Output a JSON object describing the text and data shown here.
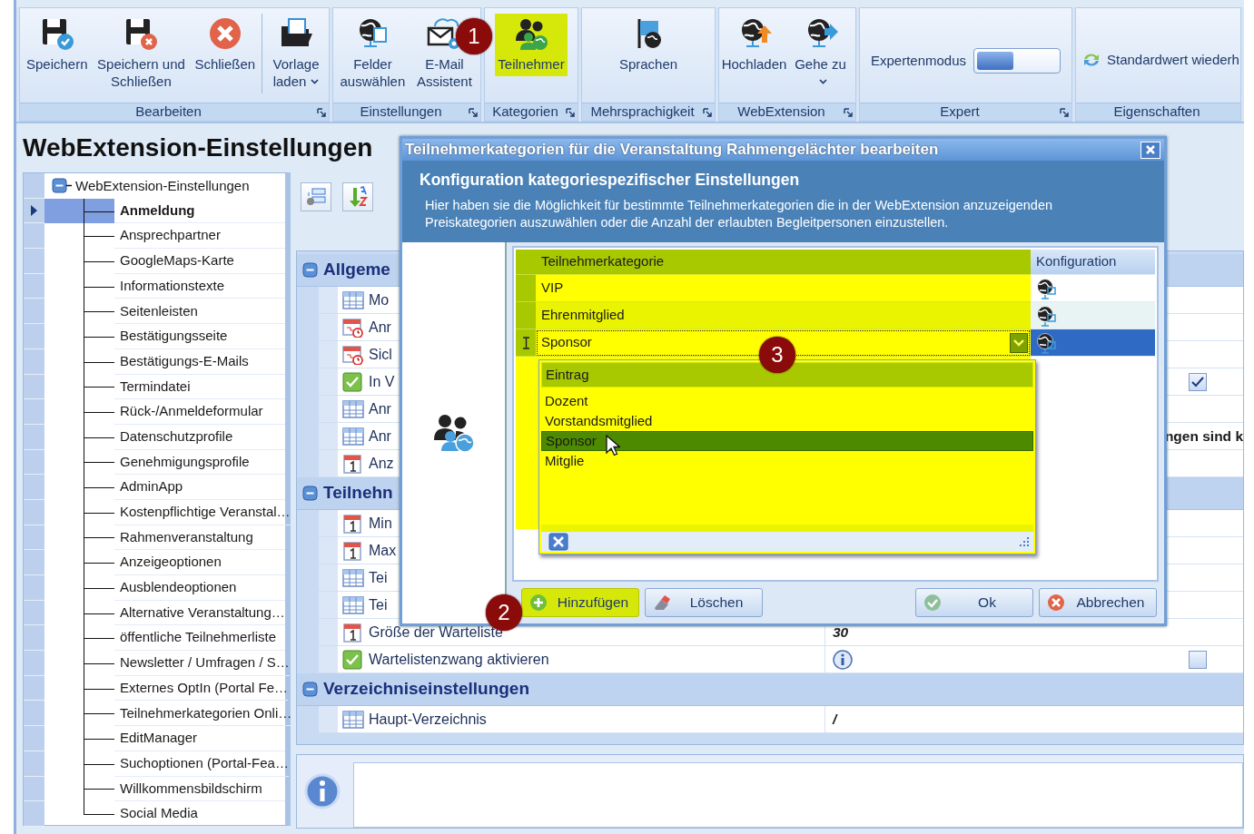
{
  "ribbon": {
    "groups": [
      {
        "label": "Bearbeiten",
        "launcher": true,
        "items": [
          {
            "kind": "button",
            "label": "Speichern",
            "highlighted": false,
            "separated": false
          },
          {
            "kind": "button",
            "label": "Speichern und Schließen",
            "highlighted": false,
            "separated": false
          },
          {
            "kind": "button",
            "label": "Schließen",
            "highlighted": false,
            "separated": false
          },
          {
            "kind": "dropdown",
            "label": "Vorlage laden",
            "highlighted": false,
            "separated": true
          }
        ]
      },
      {
        "label": "Einstellungen",
        "launcher": true,
        "items": [
          {
            "kind": "button",
            "label": "Felder auswählen",
            "highlighted": false,
            "separated": false
          },
          {
            "kind": "button",
            "label": "E-Mail Assistent",
            "highlighted": false,
            "separated": false
          }
        ]
      },
      {
        "label": "Kategorien",
        "launcher": true,
        "items": [
          {
            "kind": "button",
            "label": "Teilnehmer",
            "highlighted": true,
            "separated": false
          }
        ]
      },
      {
        "label": "Mehrsprachigkeit",
        "launcher": true,
        "items": [
          {
            "kind": "button",
            "label": "Sprachen",
            "highlighted": false,
            "separated": false
          }
        ]
      },
      {
        "label": "WebExtension",
        "launcher": true,
        "items": [
          {
            "kind": "button",
            "label": "Hochladen",
            "highlighted": false,
            "separated": false
          },
          {
            "kind": "dropdown",
            "label": "Gehe zu",
            "highlighted": false,
            "separated": false
          }
        ]
      },
      {
        "label": "Expert",
        "launcher": true,
        "items": [
          {
            "kind": "toggle",
            "label": "Expertenmodus",
            "on": false
          }
        ]
      },
      {
        "label": "Eigenschaften",
        "launcher": false,
        "items": [
          {
            "kind": "small",
            "label": "Standardwert wiederh"
          }
        ]
      }
    ]
  },
  "page_title": "WebExtension-Einstellungen",
  "tree": {
    "items": [
      {
        "label": "WebExtension-Einstellungen",
        "expanded": true,
        "selected": false,
        "children": [
          {
            "label": "Anmeldung",
            "selected": true
          },
          {
            "label": "Ansprechpartner",
            "selected": false
          },
          {
            "label": "GoogleMaps-Karte",
            "selected": false
          },
          {
            "label": "Informationstexte",
            "selected": false
          },
          {
            "label": "Seitenleisten",
            "selected": false
          },
          {
            "label": "Bestätigungsseite",
            "selected": false
          },
          {
            "label": "Bestätigungs-E-Mails",
            "selected": false
          },
          {
            "label": "Termindatei",
            "selected": false
          },
          {
            "label": "Rück-/Anmeldeformular",
            "selected": false
          },
          {
            "label": "Datenschutzprofile",
            "selected": false
          },
          {
            "label": "Genehmigungsprofile",
            "selected": false
          },
          {
            "label": "AdminApp",
            "selected": false
          },
          {
            "label": "Kostenpflichtige Veranstal…",
            "selected": false
          },
          {
            "label": "Rahmenveranstaltung",
            "selected": false
          },
          {
            "label": "Anzeigeoptionen",
            "selected": false
          },
          {
            "label": "Ausblendeoptionen",
            "selected": false
          },
          {
            "label": "Alternative Veranstaltung…",
            "selected": false
          },
          {
            "label": "öffentliche Teilnehmerliste",
            "selected": false
          },
          {
            "label": "Newsletter / Umfragen / S…",
            "selected": false
          },
          {
            "label": "Externes OptIn (Portal Fe…",
            "selected": false
          },
          {
            "label": "Teilnehmerkategorien Onli…",
            "selected": false
          },
          {
            "label": "EditManager",
            "selected": false
          },
          {
            "label": "Suchoptionen (Portal-Fea…",
            "selected": false
          },
          {
            "label": "Willkommensbildschirm",
            "selected": false
          },
          {
            "label": "Social Media",
            "selected": false
          }
        ]
      }
    ]
  },
  "property_grid": {
    "sections": [
      {
        "label": "Allgeme",
        "expanded": true,
        "rows": [
          {
            "kind": "table",
            "label": "Mo"
          },
          {
            "kind": "schedule",
            "label": "Anr"
          },
          {
            "kind": "schedule",
            "label": "Sicl"
          },
          {
            "kind": "check",
            "label": "In V",
            "value": {
              "kind": "checkbox",
              "checked": true
            }
          },
          {
            "kind": "table",
            "label": "Anr"
          },
          {
            "kind": "table",
            "label": "Anr",
            "value": {
              "kind": "cut_text",
              "text": "ngen sind k"
            }
          },
          {
            "kind": "number",
            "label": "Anz"
          }
        ]
      },
      {
        "label": "Teilnehn",
        "expanded": true,
        "rows": [
          {
            "kind": "number",
            "label": "Min"
          },
          {
            "kind": "number",
            "label": "Max"
          },
          {
            "kind": "table",
            "label": "Tei"
          },
          {
            "kind": "table",
            "label": "Tei"
          },
          {
            "kind": "number",
            "label": "Größe der Warteliste",
            "value": {
              "kind": "text",
              "text": "30"
            }
          },
          {
            "kind": "check",
            "label": "Wartelistenzwang aktivieren",
            "value": {
              "kind": "checkbox",
              "checked": false,
              "info": true
            }
          }
        ]
      },
      {
        "label": "Verzeichniseinstellungen",
        "expanded": true,
        "rows": [
          {
            "kind": "table",
            "label": "Haupt-Verzeichnis",
            "value": {
              "kind": "text",
              "text": "/"
            }
          }
        ]
      }
    ]
  },
  "dialog": {
    "title": "Teilnehmerkategorien für die Veranstaltung Rahmengelächter bearbeiten",
    "heading": "Konfiguration kategoriespezifischer Einstellungen",
    "description": "Hier haben sie die Möglichkeit für bestimmte Teilnehmerkategorien die in der WebExtension anzuzeigenden Preiskategorien auszuwählen oder die Anzahl der erlaubten Begleitpersonen einzustellen.",
    "grid": {
      "highlighted": true,
      "columns": [
        "Teilnehmerkategorie",
        "Konfiguration"
      ],
      "rows": [
        {
          "category": "VIP",
          "selected": false,
          "editing": false
        },
        {
          "category": "Ehrenmitglied",
          "selected": false,
          "editing": false
        },
        {
          "category": "Sponsor",
          "selected": true,
          "editing": true
        }
      ]
    },
    "dropdown": {
      "header": "Eintrag",
      "items": [
        {
          "label": "Dozent",
          "selected": false
        },
        {
          "label": "Vorstandsmitglied",
          "selected": false
        },
        {
          "label": "Sponsor",
          "selected": true
        },
        {
          "label": "Mitglie",
          "selected": false
        }
      ]
    },
    "buttons": [
      {
        "kind": "add",
        "label": "Hinzufügen",
        "highlighted": true
      },
      {
        "kind": "delete",
        "label": "Löschen",
        "highlighted": false
      },
      {
        "kind": "ok",
        "label": "Ok",
        "highlighted": false
      },
      {
        "kind": "cancel",
        "label": "Abbrechen",
        "highlighted": false
      }
    ]
  },
  "callouts": [
    {
      "text": "1"
    },
    {
      "text": "2"
    },
    {
      "text": "3"
    }
  ]
}
